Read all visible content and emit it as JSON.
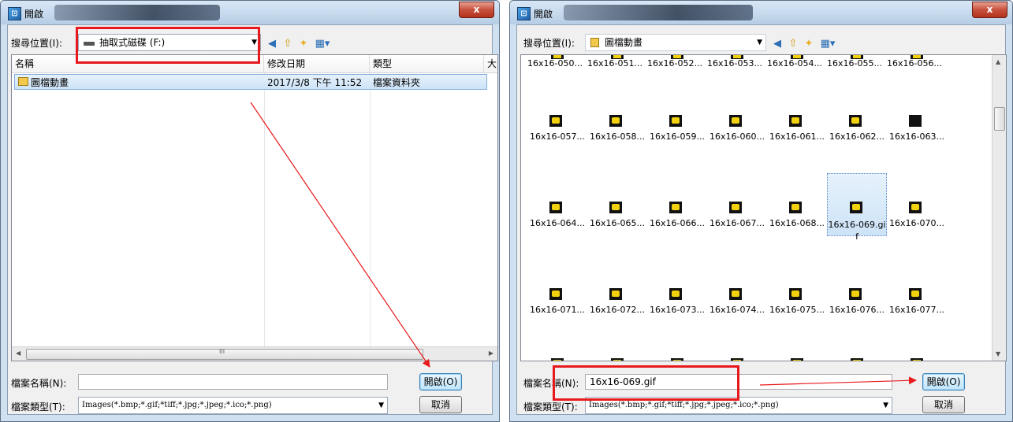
{
  "left": {
    "title": "開啟",
    "close_label": "x",
    "lookin_label": "搜尋位置(I):",
    "lookin_value": "抽取式磁碟 (F:)",
    "columns": [
      "名稱",
      "修改日期",
      "類型",
      "大"
    ],
    "row": {
      "name": "圖檔動畫",
      "date": "2017/3/8 下午 11:52",
      "type": "檔案資料夾"
    },
    "scroll_mark": "III",
    "filename_label": "檔案名稱(N):",
    "filename_value": "",
    "filetype_label": "檔案類型(T):",
    "filetype_value": "Images(*.bmp;*.gif;*tiff;*.jpg;*.jpeg;*.ico;*.png)",
    "open_label": "開啟(O)",
    "cancel_label": "取消"
  },
  "right": {
    "title": "開啟",
    "close_label": "x",
    "lookin_label": "搜尋位置(I):",
    "lookin_value": "圖檔動畫",
    "partial_captions": [
      "16x16-050...",
      "16x16-051...",
      "16x16-052...",
      "16x16-053...",
      "16x16-054...",
      "16x16-055...",
      "16x16-056..."
    ],
    "thumb_rows": [
      [
        "16x16-057...",
        "16x16-058...",
        "16x16-059...",
        "16x16-060...",
        "16x16-061...",
        "16x16-062...",
        "16x16-063..."
      ],
      [
        "16x16-064...",
        "16x16-065...",
        "16x16-066...",
        "16x16-067...",
        "16x16-068...",
        "16x16-069.gif",
        "16x16-070..."
      ],
      [
        "16x16-071...",
        "16x16-072...",
        "16x16-073...",
        "16x16-074...",
        "16x16-075...",
        "16x16-076...",
        "16x16-077..."
      ]
    ],
    "selected_file": "16x16-069.gif",
    "filename_label": "檔案名稱(N):",
    "filename_value": "16x16-069.gif",
    "filetype_label": "檔案類型(T):",
    "filetype_value": "Images(*.bmp;*.gif;*tiff;*.jpg;*.jpeg;*.ico;*.png)",
    "open_label": "開啟(O)",
    "cancel_label": "取消"
  },
  "icons": [
    "app-icon",
    "drive-icon",
    "back-icon",
    "up-folder-icon",
    "new-folder-icon",
    "view-menu-icon",
    "folder-icon"
  ],
  "colors": {
    "highlight": "#e8191c",
    "selection": "#cde3f7",
    "thumb_icon": "#f2d10e"
  }
}
